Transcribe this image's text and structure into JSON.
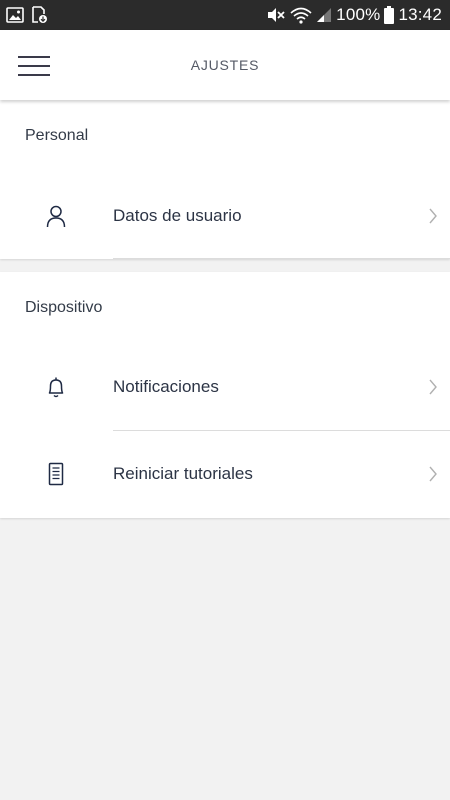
{
  "status_bar": {
    "battery_percent": "100%",
    "time": "13:42",
    "icons": [
      "image-icon",
      "download-icon",
      "mute-icon",
      "wifi-icon",
      "signal-icon",
      "battery-icon"
    ]
  },
  "app_bar": {
    "title": "AJUSTES",
    "menu_icon": "hamburger-menu-icon"
  },
  "sections": {
    "personal": {
      "header": "Personal",
      "items": [
        {
          "label": "Datos de usuario",
          "icon": "user-icon"
        }
      ]
    },
    "device": {
      "header": "Dispositivo",
      "items": [
        {
          "label": "Notificaciones",
          "icon": "bell-icon"
        },
        {
          "label": "Reiniciar tutoriales",
          "icon": "document-icon"
        }
      ]
    }
  },
  "colors": {
    "status_bar_bg": "#2b2b2b",
    "background": "#f2f2f2",
    "card_bg": "#ffffff",
    "text_primary": "#2c3445",
    "icon_color": "#1f2a44",
    "chevron_color": "#b0b0b0"
  }
}
